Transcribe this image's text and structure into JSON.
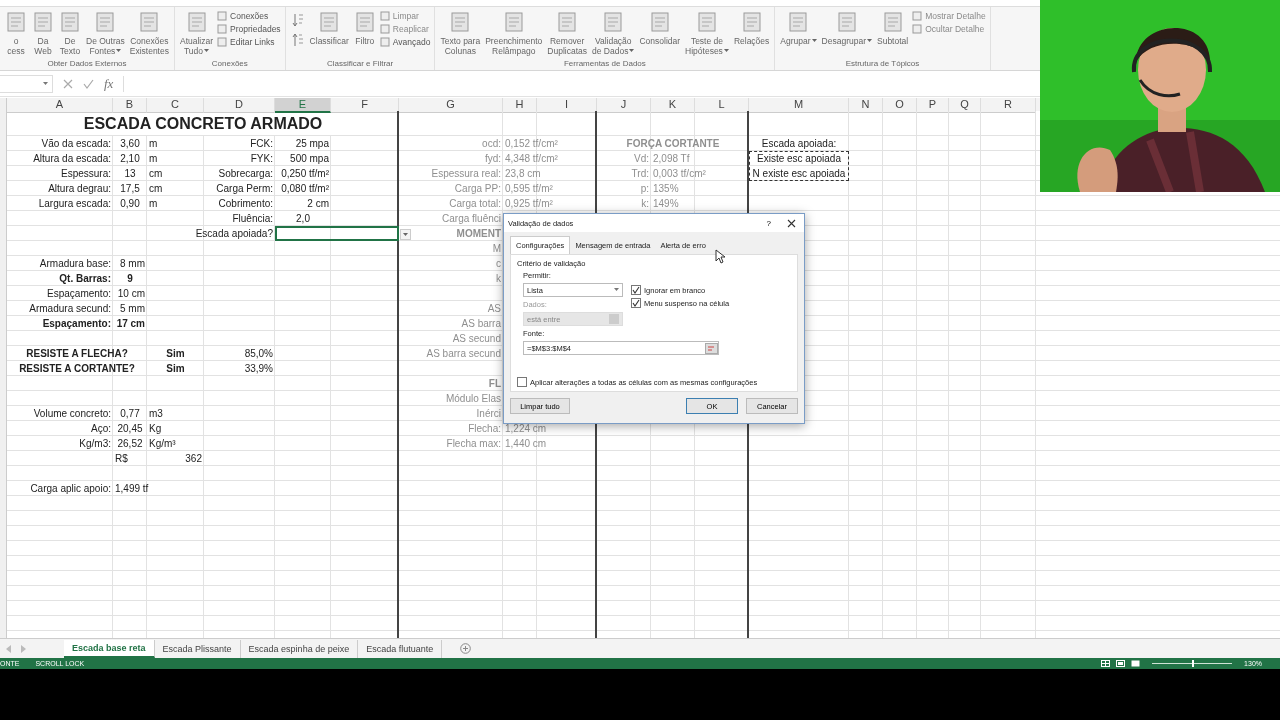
{
  "ribbon": {
    "groups": [
      {
        "label": "Obter Dados Externos",
        "items": [
          {
            "kind": "large",
            "lines": [
              "o",
              "cess"
            ],
            "menu": false
          },
          {
            "kind": "large",
            "lines": [
              "Da",
              "Web"
            ],
            "menu": false
          },
          {
            "kind": "large",
            "lines": [
              "De",
              "Texto"
            ],
            "menu": false
          },
          {
            "kind": "large",
            "lines": [
              "De Outras",
              "Fontes"
            ],
            "menu": true
          },
          {
            "kind": "large",
            "lines": [
              "Conexões",
              "Existentes"
            ],
            "menu": false
          }
        ]
      },
      {
        "label": "Conexões",
        "items": [
          {
            "kind": "large",
            "lines": [
              "Atualizar",
              "Tudo"
            ],
            "menu": true
          },
          {
            "kind": "stack",
            "items": [
              {
                "label": "Conexões",
                "disabled": false
              },
              {
                "label": "Propriedades",
                "disabled": false
              },
              {
                "label": "Editar Links",
                "disabled": false
              }
            ]
          }
        ]
      },
      {
        "label": "Classificar e Filtrar",
        "items": [
          {
            "kind": "sort"
          },
          {
            "kind": "large",
            "lines": [
              "Classificar"
            ],
            "menu": false
          },
          {
            "kind": "large",
            "lines": [
              "Filtro"
            ],
            "menu": false
          },
          {
            "kind": "stack",
            "items": [
              {
                "label": "Limpar",
                "disabled": true
              },
              {
                "label": "Reaplicar",
                "disabled": true
              },
              {
                "label": "Avançado",
                "disabled": false
              }
            ]
          }
        ]
      },
      {
        "label": "Ferramentas de Dados",
        "items": [
          {
            "kind": "large",
            "lines": [
              "Texto para",
              "Colunas"
            ],
            "menu": false
          },
          {
            "kind": "large",
            "lines": [
              "Preenchimento",
              "Relâmpago"
            ],
            "menu": false
          },
          {
            "kind": "large",
            "lines": [
              "Remover",
              "Duplicatas"
            ],
            "menu": false
          },
          {
            "kind": "large",
            "lines": [
              "Validação",
              "de Dados"
            ],
            "menu": true
          },
          {
            "kind": "large",
            "lines": [
              "Consolidar"
            ],
            "menu": false
          },
          {
            "kind": "large",
            "lines": [
              "Teste de",
              "Hipóteses"
            ],
            "menu": true
          },
          {
            "kind": "large",
            "lines": [
              "Relações"
            ],
            "menu": false
          }
        ]
      },
      {
        "label": "Estrutura de Tópicos",
        "items": [
          {
            "kind": "large",
            "lines": [
              "Agrupar"
            ],
            "menu": true
          },
          {
            "kind": "large",
            "lines": [
              "Desagrupar"
            ],
            "menu": true
          },
          {
            "kind": "large",
            "lines": [
              "Subtotal"
            ],
            "menu": false
          },
          {
            "kind": "stack",
            "items": [
              {
                "label": "Mostrar Detalhe",
                "disabled": true
              },
              {
                "label": "Ocultar Detalhe",
                "disabled": true
              }
            ]
          }
        ]
      }
    ]
  },
  "formula_bar": {
    "function_label": "fx"
  },
  "sheet": {
    "columns": [
      {
        "label": "A",
        "selected": false
      },
      {
        "label": "B",
        "selected": false
      },
      {
        "label": "C",
        "selected": false
      },
      {
        "label": "D",
        "selected": false
      },
      {
        "label": "E",
        "selected": true
      },
      {
        "label": "F",
        "selected": false
      },
      {
        "label": "G",
        "selected": false
      },
      {
        "label": "H",
        "selected": false
      },
      {
        "label": "I",
        "selected": false
      },
      {
        "label": "J",
        "selected": false
      },
      {
        "label": "K",
        "selected": false
      },
      {
        "label": "L",
        "selected": false
      },
      {
        "label": "M",
        "selected": false
      },
      {
        "label": "N",
        "selected": false
      },
      {
        "label": "O",
        "selected": false
      },
      {
        "label": "P",
        "selected": false
      },
      {
        "label": "Q",
        "selected": false
      },
      {
        "label": "R",
        "selected": false
      }
    ],
    "cells": {
      "A1:F1": {
        "kind": "title",
        "text": "ESCADA CONCRETO ARMADO"
      },
      "A2": {
        "kind": "label",
        "text": "Vão da escada:"
      },
      "B2": {
        "kind": "num",
        "text": "3,60"
      },
      "C2": {
        "kind": "unit",
        "text": "m"
      },
      "D2": {
        "kind": "label",
        "text": "FCK:"
      },
      "E2": {
        "kind": "value",
        "text": "25 mpa"
      },
      "G2": {
        "kind": "muted-label",
        "text": "ocd:"
      },
      "H2": {
        "kind": "muted-value",
        "text": "0,152 tf/cm²"
      },
      "J2:L2": {
        "kind": "muted-head",
        "text": "FORÇA CORTANTE"
      },
      "M2": {
        "kind": "center",
        "text": "Escada apoiada:"
      },
      "A3": {
        "kind": "label",
        "text": "Altura da escada:"
      },
      "B3": {
        "kind": "num",
        "text": "2,10"
      },
      "C3": {
        "kind": "unit",
        "text": "m"
      },
      "D3": {
        "kind": "label",
        "text": "FYK:"
      },
      "E3": {
        "kind": "value",
        "text": "500 mpa"
      },
      "G3": {
        "kind": "muted-label",
        "text": "fyd:"
      },
      "H3": {
        "kind": "muted-value",
        "text": "4,348 tf/cm²"
      },
      "J3": {
        "kind": "muted-label",
        "text": "Vd:"
      },
      "K3": {
        "kind": "muted-value",
        "text": "2,098 Tf"
      },
      "M3": {
        "kind": "center",
        "text": "Existe esc apoiada"
      },
      "A4": {
        "kind": "label",
        "text": "Espessura:"
      },
      "B4": {
        "kind": "num",
        "text": "13"
      },
      "C4": {
        "kind": "unit",
        "text": "cm"
      },
      "D4": {
        "kind": "label",
        "text": "Sobrecarga:"
      },
      "E4": {
        "kind": "value",
        "text": "0,250 tf/m²"
      },
      "G4": {
        "kind": "muted-label",
        "text": "Espessura real:"
      },
      "H4": {
        "kind": "muted-value",
        "text": "23,8 cm"
      },
      "J4": {
        "kind": "muted-label",
        "text": "Trd:"
      },
      "K4": {
        "kind": "muted-value",
        "text": "0,003 tf/cm²"
      },
      "M4": {
        "kind": "center",
        "text": "N existe esc apoiada"
      },
      "A5": {
        "kind": "label",
        "text": "Altura degrau:"
      },
      "B5": {
        "kind": "num",
        "text": "17,5"
      },
      "C5": {
        "kind": "unit",
        "text": "cm"
      },
      "D5": {
        "kind": "label",
        "text": "Carga Perm:"
      },
      "E5": {
        "kind": "value",
        "text": "0,080 tf/m²"
      },
      "G5": {
        "kind": "muted-label",
        "text": "Carga PP:"
      },
      "H5": {
        "kind": "muted-value",
        "text": "0,595 tf/m²"
      },
      "J5": {
        "kind": "muted-label",
        "text": "p:"
      },
      "K5": {
        "kind": "muted-value",
        "text": "135%"
      },
      "A6": {
        "kind": "label",
        "text": "Largura escada:"
      },
      "B6": {
        "kind": "num",
        "text": "0,90"
      },
      "C6": {
        "kind": "unit",
        "text": "m"
      },
      "D6": {
        "kind": "label",
        "text": "Cobrimento:"
      },
      "E6": {
        "kind": "value",
        "text": "2 cm"
      },
      "G6": {
        "kind": "muted-label",
        "text": "Carga total:"
      },
      "H6": {
        "kind": "muted-value",
        "text": "0,925 tf/m²"
      },
      "J6": {
        "kind": "muted-label",
        "text": "k:"
      },
      "K6": {
        "kind": "muted-value",
        "text": "149%"
      },
      "D7": {
        "kind": "label",
        "text": "Fluência:"
      },
      "E7": {
        "kind": "center",
        "text": "2,0"
      },
      "G7": {
        "kind": "muted-label",
        "text": "Carga fluênci"
      },
      "D8": {
        "kind": "label",
        "text": "Escada apoiada?"
      },
      "G8": {
        "kind": "muted-bold-label",
        "text": "MOMENT"
      },
      "G9": {
        "kind": "muted-label",
        "text": "M"
      },
      "A10": {
        "kind": "label",
        "text": "Armadura base:"
      },
      "B10": {
        "kind": "value",
        "text": "8 mm"
      },
      "G10": {
        "kind": "muted-label",
        "text": "c"
      },
      "A11": {
        "kind": "bold-label",
        "text": "Qt. Barras:"
      },
      "B11": {
        "kind": "bold-num",
        "text": "9"
      },
      "G11": {
        "kind": "muted-label",
        "text": "k"
      },
      "A12": {
        "kind": "label",
        "text": "Espaçamento:"
      },
      "B12": {
        "kind": "value",
        "text": "10 cm"
      },
      "A13": {
        "kind": "label",
        "text": "Armadura secund:"
      },
      "B13": {
        "kind": "value",
        "text": "5 mm"
      },
      "G13": {
        "kind": "muted-label",
        "text": "AS"
      },
      "A14": {
        "kind": "bold-label",
        "text": "Espaçamento:"
      },
      "B14": {
        "kind": "bold-value",
        "text": "17 cm"
      },
      "G14": {
        "kind": "muted-label",
        "text": "AS barra"
      },
      "G15": {
        "kind": "muted-label",
        "text": "AS secund"
      },
      "A16:B16": {
        "kind": "bold-center",
        "text": "RESISTE A FLECHA?"
      },
      "C16": {
        "kind": "bold-num",
        "text": "Sim"
      },
      "D16": {
        "kind": "value",
        "text": "85,0%"
      },
      "G16": {
        "kind": "muted-label",
        "text": "AS barra secund"
      },
      "A17:B17": {
        "kind": "bold-center",
        "text": "RESISTE A CORTANTE?"
      },
      "C17": {
        "kind": "bold-num",
        "text": "Sim"
      },
      "D17": {
        "kind": "value",
        "text": "33,9%"
      },
      "G18": {
        "kind": "muted-bold-label",
        "text": "FL"
      },
      "G19": {
        "kind": "muted-label",
        "text": "Módulo Elas"
      },
      "A20": {
        "kind": "label",
        "text": "Volume concreto:"
      },
      "B20": {
        "kind": "num",
        "text": "0,77"
      },
      "C20": {
        "kind": "unit",
        "text": "m3"
      },
      "G20": {
        "kind": "muted-label",
        "text": "Inérci"
      },
      "A21": {
        "kind": "label",
        "text": "Aço:"
      },
      "B21": {
        "kind": "num",
        "text": "20,45"
      },
      "C21": {
        "kind": "unit",
        "text": "Kg"
      },
      "G21": {
        "kind": "muted-label",
        "text": "Flecha:"
      },
      "H21": {
        "kind": "muted-value",
        "text": "1,224 cm"
      },
      "A22": {
        "kind": "label",
        "text": "Kg/m3:"
      },
      "B22": {
        "kind": "num",
        "text": "26,52"
      },
      "C22": {
        "kind": "unit",
        "text": "Kg/m³"
      },
      "G22": {
        "kind": "muted-label",
        "text": "Flecha max:"
      },
      "H22": {
        "kind": "muted-value",
        "text": "1,440 cm"
      },
      "B23": {
        "kind": "unit",
        "text": "R$"
      },
      "C23": {
        "kind": "value",
        "text": "362"
      },
      "A25": {
        "kind": "label",
        "text": "Carga aplic apoio:"
      },
      "B25": {
        "kind": "unit",
        "text": "1,499 tf"
      }
    },
    "marks": {
      "E8:F8": {
        "kind": "active"
      },
      "M3:M4": {
        "kind": "copy"
      }
    }
  },
  "dialog": {
    "title": "Validação de dados",
    "help": "?",
    "tabs": [
      {
        "label": "Configurações",
        "selected": true
      },
      {
        "label": "Mensagem de entrada",
        "selected": false
      },
      {
        "label": "Alerta de erro",
        "selected": false
      }
    ],
    "section": "Critério de validação",
    "allow_label": "Permitir:",
    "allow_value": "Lista",
    "options": [
      {
        "label": "Ignorar em branco",
        "checked": true
      },
      {
        "label": "Menu suspenso na célula",
        "checked": true
      }
    ],
    "data_label": "Dados:",
    "data_value": "está entre",
    "data_disabled": true,
    "source_label": "Fonte:",
    "source_value": "=$M$3:$M$4",
    "apply_all": {
      "label": "Aplicar alterações a todas as células com as mesmas configurações",
      "checked": false
    },
    "buttons": [
      {
        "label": "Limpar tudo",
        "kind": "secondary"
      },
      {
        "label": "OK",
        "kind": "default"
      },
      {
        "label": "Cancelar",
        "kind": "secondary"
      }
    ]
  },
  "sheet_tabs": [
    {
      "label": "Escada base reta",
      "selected": true
    },
    {
      "label": "Escada Plissante",
      "selected": false
    },
    {
      "label": "Escada espinha de peixe",
      "selected": false
    },
    {
      "label": "Escada flutuante",
      "selected": false
    }
  ],
  "status_bar": {
    "left": [
      "ONTE",
      "SCROLL LOCK"
    ],
    "zoom": "130%",
    "zoom_slider": {
      "level": 0.5
    }
  }
}
